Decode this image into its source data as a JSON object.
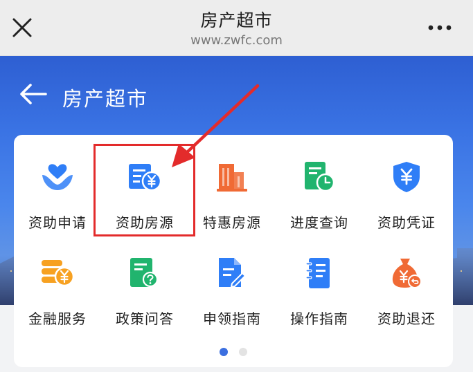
{
  "topbar": {
    "title": "房产超市",
    "url": "www.zwfc.com"
  },
  "header": {
    "title": "房产超市"
  },
  "grid": {
    "row1": [
      {
        "label": "资助申请",
        "icon": "heart-hands-icon",
        "color": "#2f7ef7"
      },
      {
        "label": "资助房源",
        "icon": "card-yuan-icon",
        "color": "#2f7ef7"
      },
      {
        "label": "特惠房源",
        "icon": "building-icon",
        "color": "#f06a35"
      },
      {
        "label": "进度查询",
        "icon": "doc-clock-icon",
        "color": "#21b46e"
      },
      {
        "label": "资助凭证",
        "icon": "shield-yuan-icon",
        "color": "#2f7ef7"
      }
    ],
    "row2": [
      {
        "label": "金融服务",
        "icon": "coins-yuan-icon",
        "color": "#f7a121"
      },
      {
        "label": "政策问答",
        "icon": "doc-question-icon",
        "color": "#21b46e"
      },
      {
        "label": "申领指南",
        "icon": "doc-pen-icon",
        "color": "#2f7ef7"
      },
      {
        "label": "操作指南",
        "icon": "notebook-icon",
        "color": "#2f7ef7"
      },
      {
        "label": "资助退还",
        "icon": "moneybag-return-icon",
        "color": "#f06a35"
      }
    ]
  },
  "pager": {
    "current": 1,
    "total": 2
  },
  "annotation": {
    "highlight_color": "#e32b2b",
    "target": "资助房源"
  }
}
